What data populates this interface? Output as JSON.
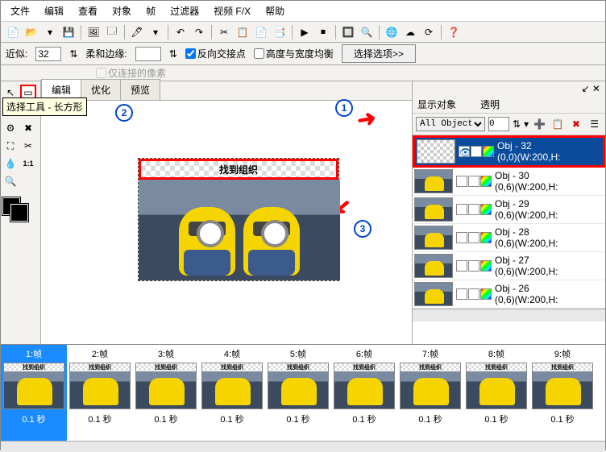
{
  "menu": [
    "文件",
    "编辑",
    "查看",
    "对象",
    "帧",
    "过滤器",
    "视频 F/X",
    "帮助"
  ],
  "optbar": {
    "approx_label": "近似:",
    "approx_val": "32",
    "soft_label": "柔和边缘:",
    "soft_val": " ",
    "chk1": "反向交接点",
    "chk2": "高度与宽度均衡",
    "chk3": "仅连接的像素",
    "prefs": "选择选项>>"
  },
  "tabs": [
    "编辑",
    "优化",
    "预览"
  ],
  "tooltip": "选择工具 - 长方形",
  "caption": "找到组织",
  "badges": {
    "b1": "1",
    "b2": "2",
    "b3": "3"
  },
  "side": {
    "h1": "显示对象",
    "h2": "透明",
    "sel": "All Object▾",
    "opacity": "0"
  },
  "objects": [
    {
      "name": "Obj - 32",
      "pos": "(0,0)(W:200,H:"
    },
    {
      "name": "Obj - 30",
      "pos": "(0,6)(W:200,H:"
    },
    {
      "name": "Obj - 29",
      "pos": "(0,6)(W:200,H:"
    },
    {
      "name": "Obj - 28",
      "pos": "(0,6)(W:200,H:"
    },
    {
      "name": "Obj - 27",
      "pos": "(0,6)(W:200,H:"
    },
    {
      "name": "Obj - 26",
      "pos": "(0,6)(W:200,H:"
    }
  ],
  "frames": [
    {
      "label": "1:帧",
      "time": "0.1 秒"
    },
    {
      "label": "2:帧",
      "time": "0.1 秒"
    },
    {
      "label": "3:帧",
      "time": "0.1 秒"
    },
    {
      "label": "4:帧",
      "time": "0.1 秒"
    },
    {
      "label": "5:帧",
      "time": "0.1 秒"
    },
    {
      "label": "6:帧",
      "time": "0.1 秒"
    },
    {
      "label": "7:帧",
      "time": "0.1 秒"
    },
    {
      "label": "8:帧",
      "time": "0.1 秒"
    },
    {
      "label": "9:帧",
      "time": "0.1 秒"
    }
  ],
  "thumb_caption": "找到组织"
}
